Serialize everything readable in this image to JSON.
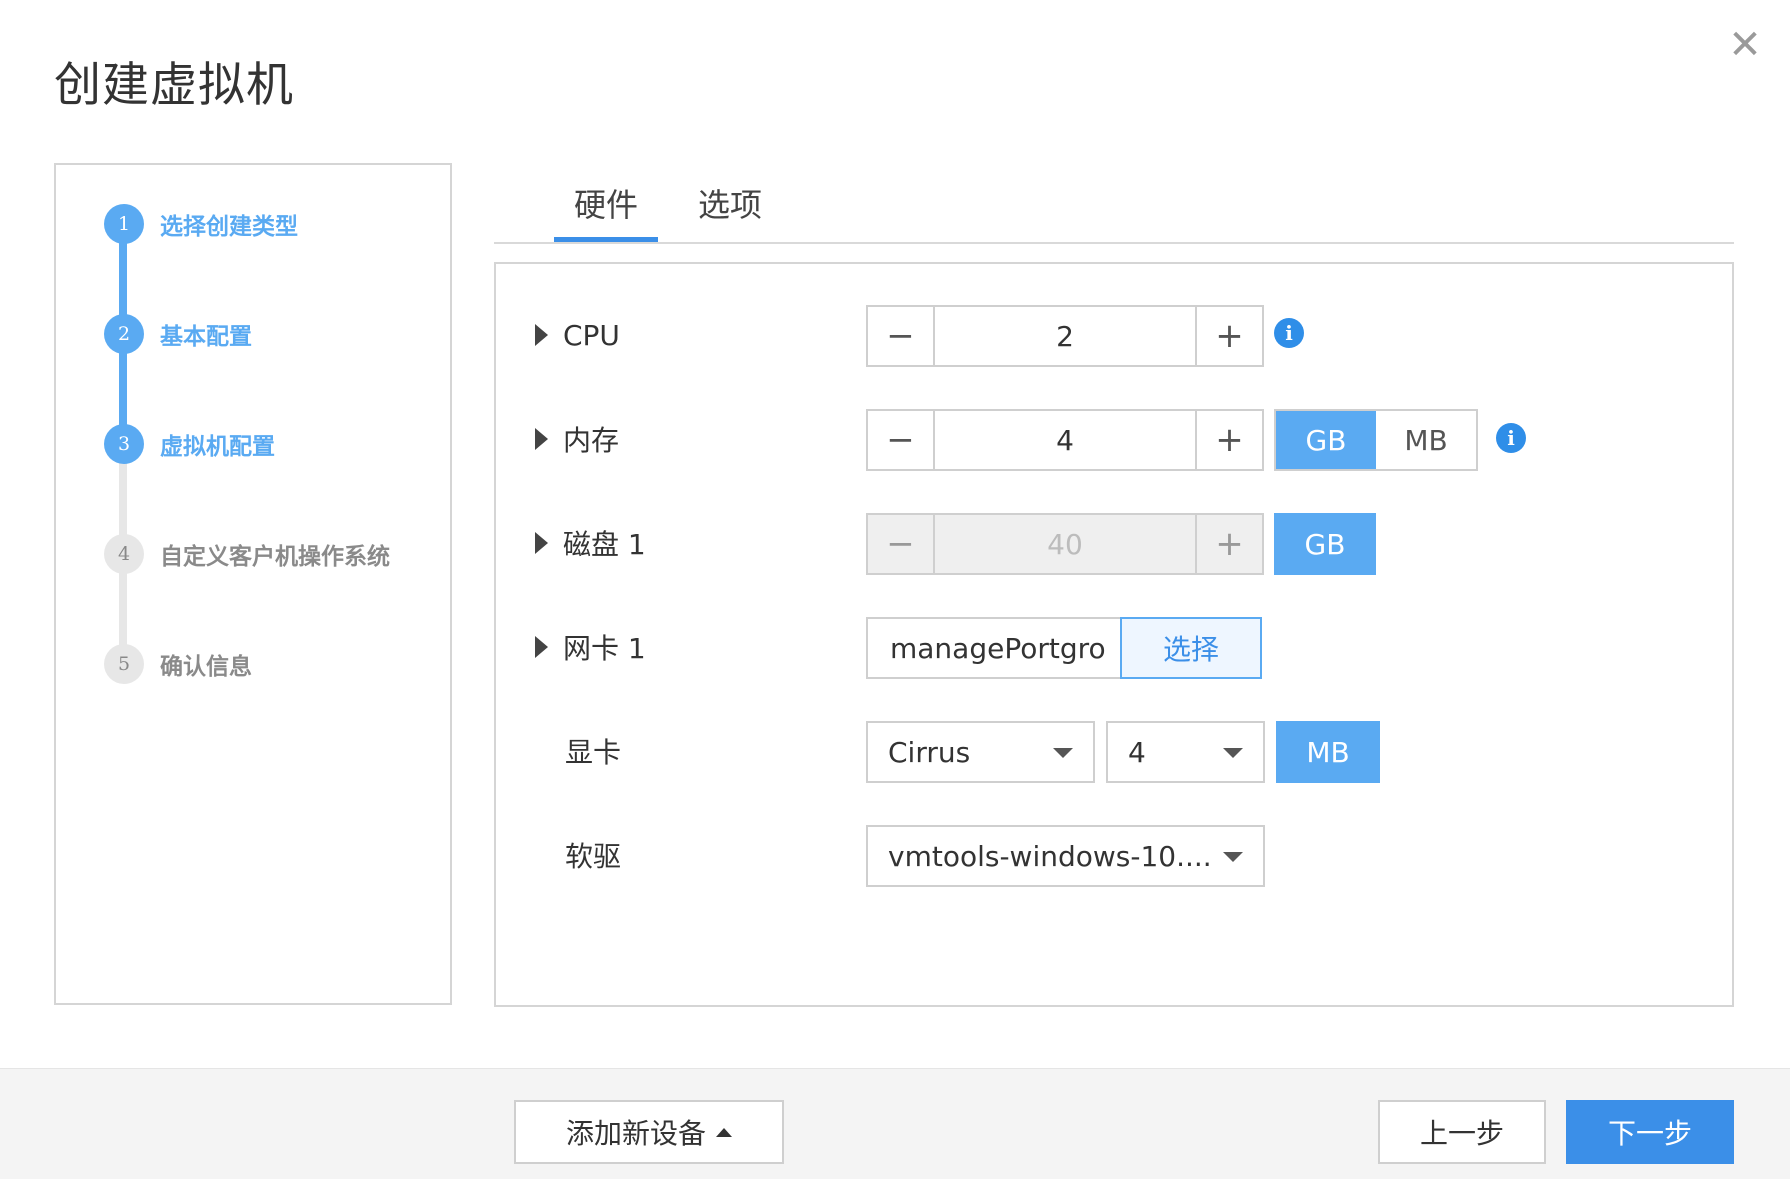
{
  "dialog": {
    "title": "创建虚拟机",
    "close_icon": "close-icon"
  },
  "steps": [
    {
      "number": "1",
      "label": "选择创建类型",
      "state": "active"
    },
    {
      "number": "2",
      "label": "基本配置",
      "state": "active"
    },
    {
      "number": "3",
      "label": "虚拟机配置",
      "state": "active"
    },
    {
      "number": "4",
      "label": "自定义客户机操作系统",
      "state": "inactive"
    },
    {
      "number": "5",
      "label": "确认信息",
      "state": "inactive"
    }
  ],
  "tabs": {
    "hardware": "硬件",
    "options": "选项",
    "active": "硬件"
  },
  "hardware": {
    "cpu": {
      "label": "CPU",
      "value": "2",
      "minus": "−",
      "plus": "+"
    },
    "memory": {
      "label": "内存",
      "value": "4",
      "minus": "−",
      "plus": "+",
      "unit_gb": "GB",
      "unit_mb": "MB",
      "selected_unit": "GB"
    },
    "disk": {
      "label": "磁盘 1",
      "value": "40",
      "minus": "−",
      "plus": "+",
      "unit": "GB"
    },
    "nic": {
      "label": "网卡 1",
      "value": "managePortgro",
      "select_button": "选择"
    },
    "video": {
      "label": "显卡",
      "type": "Cirrus",
      "size": "4",
      "unit": "MB"
    },
    "floppy": {
      "label": "软驱",
      "value": "vmtools-windows-10...."
    },
    "info_icon": "i"
  },
  "footer": {
    "add_device": "添加新设备",
    "prev": "上一步",
    "next": "下一步"
  },
  "colors": {
    "accent": "#5aaaf2",
    "primary": "#3b8fe8",
    "info": "#2f8ee8"
  }
}
